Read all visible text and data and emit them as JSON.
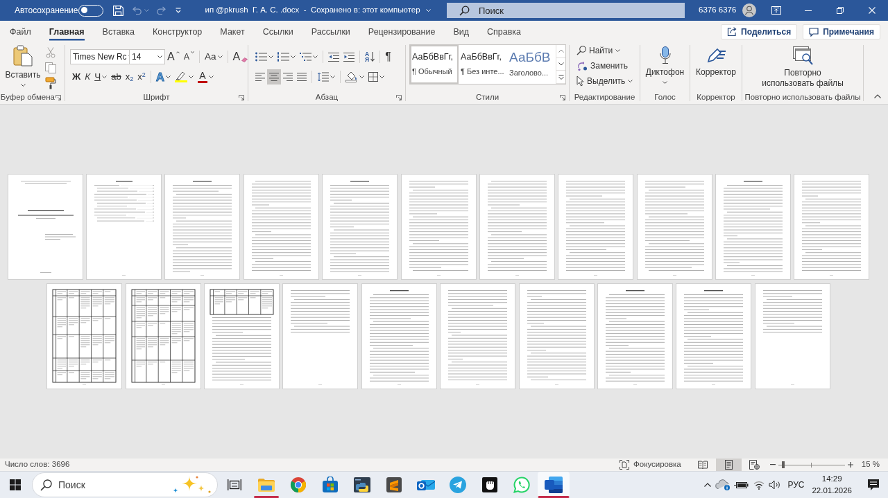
{
  "title_bar": {
    "autosave": {
      "label": "Автосохранение",
      "on": false
    },
    "quick_access": [
      {
        "kind": "save",
        "disabled": false
      },
      {
        "kind": "undo",
        "disabled": true
      },
      {
        "kind": "redo",
        "disabled": true
      },
      {
        "kind": "customize",
        "disabled": false
      }
    ],
    "document_title": "ип @pkrush  Г. А. С. .docx  -  Сохранено в: этот компьютер",
    "search_placeholder": "Поиск",
    "user_name": "6376 6376"
  },
  "ribbon_tabs": [
    {
      "label": "Файл",
      "selected": false
    },
    {
      "label": "Главная",
      "selected": true
    },
    {
      "label": "Вставка",
      "selected": false
    },
    {
      "label": "Конструктор",
      "selected": false
    },
    {
      "label": "Макет",
      "selected": false
    },
    {
      "label": "Ссылки",
      "selected": false
    },
    {
      "label": "Рассылки",
      "selected": false
    },
    {
      "label": "Рецензирование",
      "selected": false
    },
    {
      "label": "Вид",
      "selected": false
    },
    {
      "label": "Справка",
      "selected": false
    }
  ],
  "share_button": "Поделиться",
  "comments_button": "Примечания",
  "ribbon": {
    "clipboard": {
      "paste": "Вставить",
      "tools": [
        {
          "kind": "cut",
          "disabled": true
        },
        {
          "kind": "copy",
          "disabled": true
        },
        {
          "kind": "format-painter",
          "disabled": false
        }
      ],
      "label": "Буфер обмена"
    },
    "font": {
      "font_name": "Times New Rc",
      "font_size": "14",
      "grow": "A",
      "shrink": "A",
      "change_case": "Aa",
      "clear_formatting": "A",
      "styles": [
        {
          "kind": "bold",
          "glyph": "Ж"
        },
        {
          "kind": "italic",
          "glyph": "К"
        },
        {
          "kind": "underline",
          "glyph": "Ч"
        },
        {
          "kind": "strikethrough",
          "glyph": "ab"
        },
        {
          "kind": "subscript",
          "glyph": "x$_{2}$"
        },
        {
          "kind": "superscript",
          "glyph": "x$^{2}$"
        }
      ],
      "text_effects": "A",
      "font_color": "A",
      "label": "Шрифт"
    },
    "paragraph": {
      "alignment": [
        {
          "kind": "left",
          "selected": false
        },
        {
          "kind": "center",
          "selected": true
        },
        {
          "kind": "right",
          "selected": false
        },
        {
          "kind": "justify",
          "selected": false
        }
      ],
      "sort_letters": [
        "А",
        "Я"
      ],
      "pilcrow": "¶",
      "label": "Абзац"
    },
    "styles": {
      "items": [
        {
          "kind": "normal",
          "sample": "АаБбВвГг,",
          "name": "¶ Обычный",
          "selected": true
        },
        {
          "kind": "normal",
          "sample": "АаБбВвГг,",
          "name": "¶ Без инте...",
          "selected": false
        },
        {
          "kind": "heading",
          "sample": "АаБбВ",
          "name": "Заголово...",
          "selected": false
        }
      ],
      "label": "Стили"
    },
    "editing": {
      "items": [
        {
          "kind": "find",
          "label": "Найти",
          "dropdown": true
        },
        {
          "kind": "replace",
          "label": "Заменить",
          "dropdown": false
        },
        {
          "kind": "select",
          "label": "Выделить",
          "dropdown": true
        }
      ],
      "label": "Редактирование"
    },
    "voice": {
      "button": "Диктофон",
      "label": "Голос"
    },
    "editor": {
      "button": "Корректор",
      "label": "Корректор"
    },
    "reuse": {
      "button": "Повторно использовать файлы",
      "label": "Повторно использовать файлы"
    }
  },
  "document_pages": [
    {
      "kind": "title"
    },
    {
      "kind": "contents"
    },
    {
      "kind": "heading-text"
    },
    {
      "kind": "text"
    },
    {
      "kind": "heading-text"
    },
    {
      "kind": "text"
    },
    {
      "kind": "text"
    },
    {
      "kind": "text"
    },
    {
      "kind": "text"
    },
    {
      "kind": "heading-text"
    },
    {
      "kind": "text"
    },
    {
      "kind": "table"
    },
    {
      "kind": "table"
    },
    {
      "kind": "table-and-text"
    },
    {
      "kind": "partial-text"
    },
    {
      "kind": "heading-text"
    },
    {
      "kind": "text"
    },
    {
      "kind": "text"
    },
    {
      "kind": "heading-text"
    },
    {
      "kind": "heading-text"
    },
    {
      "kind": "partial-text"
    }
  ],
  "status_bar": {
    "word_count": "Число слов: 3696",
    "focus": "Фокусировка",
    "views": [
      {
        "kind": "read",
        "selected": false
      },
      {
        "kind": "print",
        "selected": true
      },
      {
        "kind": "web",
        "selected": false
      }
    ],
    "zoom": {
      "level": 0.08,
      "reading": "15 %"
    }
  },
  "taskbar": {
    "search_placeholder": "Поиск",
    "apps": [
      {
        "kind": "task-view",
        "running": false,
        "focused": false
      },
      {
        "kind": "explorer",
        "running": true,
        "focused": false
      },
      {
        "kind": "browser",
        "running": false,
        "focused": false
      },
      {
        "kind": "store",
        "running": false,
        "focused": false
      },
      {
        "kind": "python",
        "running": false,
        "focused": false
      },
      {
        "kind": "editor",
        "running": false,
        "focused": false
      },
      {
        "kind": "mail",
        "running": false,
        "focused": false
      },
      {
        "kind": "messenger",
        "running": false,
        "focused": false
      },
      {
        "kind": "fist",
        "running": false,
        "focused": false
      },
      {
        "kind": "chat",
        "running": false,
        "focused": false
      },
      {
        "kind": "word",
        "running": true,
        "focused": true
      }
    ],
    "language": "РУС",
    "time": "14:29",
    "date": "22.01.2026"
  }
}
